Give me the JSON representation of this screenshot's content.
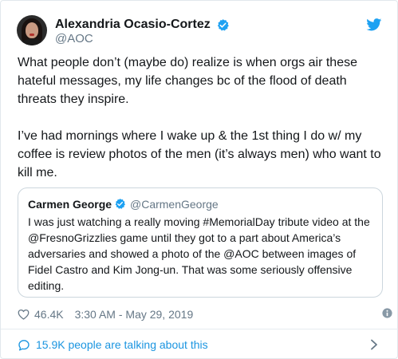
{
  "tweet": {
    "author": {
      "name": "Alexandria Ocasio-Cortez",
      "handle": "@AOC"
    },
    "paragraphs": [
      "What people don’t (maybe do) realize is when orgs air these hateful messages, my life changes bc of the flood of death threats they inspire.",
      "I’ve had mornings where I wake up & the 1st thing I do w/ my coffee is review photos of the men (it’s always men) who want to kill me."
    ],
    "quoted": {
      "name": "Carmen George",
      "handle": "@CarmenGeorge",
      "text": "I was just watching a really moving #MemorialDay tribute video at the @FresnoGrizzlies game until they got to a part about America’s adversaries and showed a photo of the @AOC between images of Fidel Castro and Kim Jong-un. That was some seriously offensive editing."
    },
    "likes": "46.4K",
    "timestamp": "3:30 AM - May 29, 2019",
    "conversation": "15.9K people are talking about this"
  },
  "icons": {
    "verified": "verified-badge-icon",
    "brand": "twitter-bird-icon",
    "like": "heart-icon",
    "info": "info-icon",
    "conversation": "speech-bubble-icon",
    "chevron": "chevron-right-icon"
  },
  "colors": {
    "brand": "#1da1f2",
    "link": "#1b95e0",
    "muted": "#657786",
    "text": "#14171a",
    "border": "#ccd6dd"
  }
}
